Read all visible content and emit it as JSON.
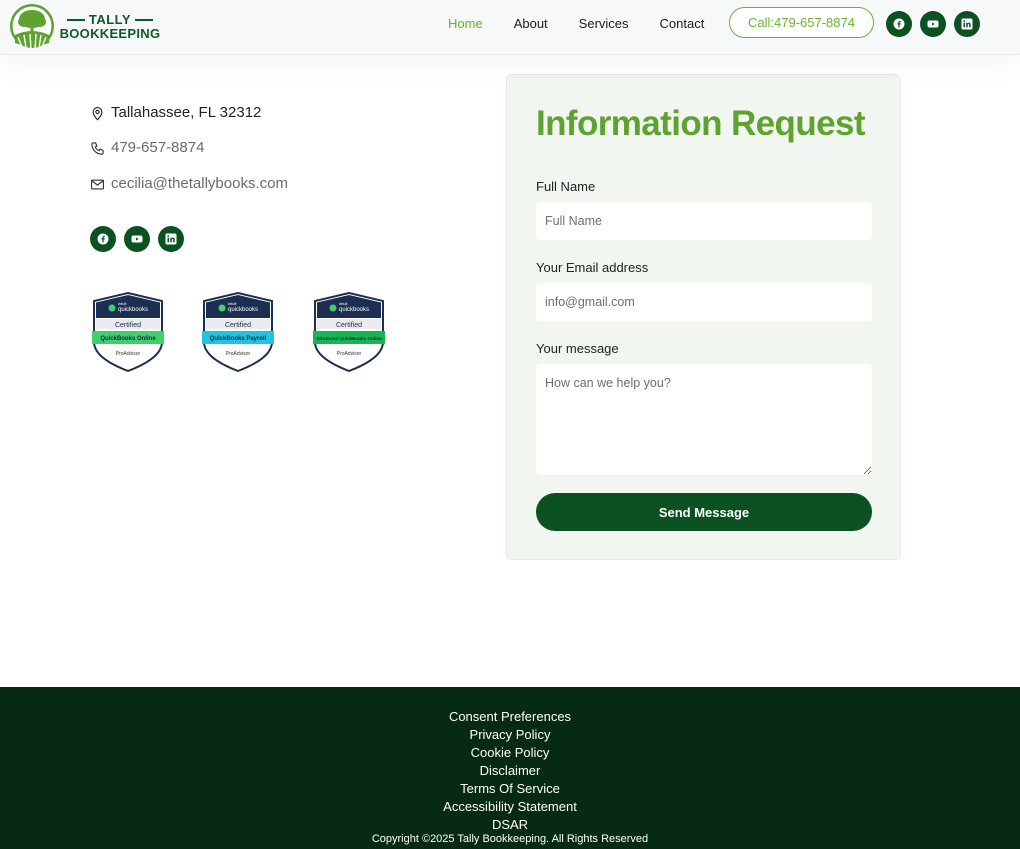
{
  "brand": {
    "logo_top": "TALLY",
    "logo_bottom": "BOOKKEEPING",
    "primary_color": "#0b5122",
    "accent_color": "#6bb32e"
  },
  "nav": {
    "items": [
      {
        "label": "Home",
        "active": true
      },
      {
        "label": "About",
        "active": false
      },
      {
        "label": "Services",
        "active": false
      },
      {
        "label": "Contact",
        "active": false
      }
    ],
    "call_button": "Call:479-657-8874",
    "social_icons": [
      "facebook-icon",
      "youtube-icon",
      "linkedin-icon"
    ]
  },
  "contact": {
    "address": "Tallahassee, FL 32312",
    "phone": "479-657-8874",
    "email": "cecilia@thetallybooks.com",
    "social_icons": [
      "facebook-icon",
      "youtube-icon",
      "linkedin-icon"
    ]
  },
  "badges": [
    {
      "brand_small": "intuit",
      "brand": "quickbooks",
      "certified": "Certified",
      "product": "QuickBooks Online",
      "role": "ProAdvisor",
      "band_color": "#3fd06b"
    },
    {
      "brand_small": "intuit",
      "brand": "quickbooks",
      "certified": "Certified",
      "product": "QuickBooks Payroll",
      "role": "ProAdvisor",
      "band_color": "#1fc4e0"
    },
    {
      "brand_small": "intuit",
      "brand": "quickbooks",
      "certified": "Certified",
      "product": "Advanced QuickBooks Online",
      "role": "ProAdvisor",
      "band_color": "#13b851"
    }
  ],
  "form": {
    "title": "Information Request",
    "full_name_label": "Full Name",
    "full_name_placeholder": "Full Name",
    "email_label": "Your Email address",
    "email_placeholder": "info@gmail.com",
    "message_label": "Your message",
    "message_placeholder": "How can we help you?",
    "submit_label": "Send Message"
  },
  "footer": {
    "links": [
      "Consent Preferences",
      "Privacy Policy",
      "Cookie Policy",
      "Disclaimer",
      "Terms Of Service",
      "Accessibility Statement",
      "DSAR"
    ],
    "copyright": "Copyright ©2025 Tally Bookkeeping. All Rights Reserved"
  }
}
